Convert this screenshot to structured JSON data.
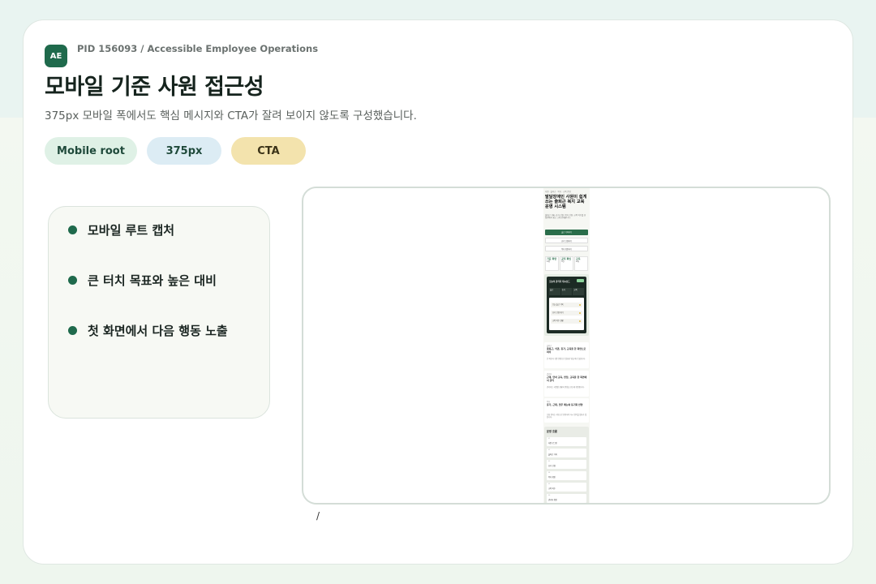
{
  "header": {
    "brand_badge": "AE",
    "pid_text": "PID 156093 / Accessible Employee Operations",
    "title": "모바일 기준 사원 접근성",
    "subtitle": "375px 모바일 폭에서도 핵심 메시지와 CTA가 잘려 보이지 않도록 구성했습니다."
  },
  "chips": [
    "Mobile root",
    "375px",
    "CTA"
  ],
  "colors": {
    "accent": "#1f6a4c",
    "chip_green": "#dff1e6",
    "chip_blue": "#dcecf4",
    "chip_yellow": "#f3e3ad"
  },
  "bullets": [
    "모바일 루트 캡처",
    "큰 터치 목표와 높은 대비",
    "첫 화면에서 다음 행동 노출"
  ],
  "preview_caption": "/",
  "mobile": {
    "top_label": "사원 · 출퇴근 · 복지 · 교육 운영",
    "headline": "발달장애인 사원이 쉽게 쓰는 출퇴근 복지 교육 운영 시스템",
    "intro": "출퇴근 기록, 휴가 신청, 복지 신청, 교육 이수를 한 화면에서 쉽고 크게 안내합니다.",
    "primary_button": "출근 기록하기",
    "button_2": "휴가 신청하기",
    "button_3": "복지 확인하기",
    "stats": [
      {
        "label": "기준 화면",
        "value": "1개"
      },
      {
        "label": "공지 확인",
        "value": "3건"
      },
      {
        "label": "교육",
        "value": "2개"
      }
    ],
    "dashboard": {
      "title": "오늘의 관리자 대시보드",
      "kpis": [
        "출근",
        "휴가",
        "교육"
      ],
      "rows": [
        "오늘 출근 기록",
        "휴가 신청 대기",
        "교육 이수 현황"
      ]
    },
    "sections": [
      {
        "tag": "출퇴근",
        "title": "출퇴근, 식권, 휴가, 교육을 한 화면으로 처리",
        "text": "큰 버튼과 쉬운 문장으로 필요한 일을 바로 찾습니다."
      },
      {
        "tag": "관리자",
        "title": "근태, 연차 교육, 면담, 교육을 한 화면에서 관리",
        "text": "관리자는 사원별 현황과 알림을 한눈에 확인합니다."
      },
      {
        "tag": "복지",
        "title": "휴가, 근태, 업무 메뉴와 동기화 반영",
        "text": "신청 결과는 자동으로 반영되어 다시 입력할 필요가 없습니다."
      }
    ],
    "flow": {
      "title": "운영 흐름",
      "steps": [
        {
          "num": "01",
          "label": "사원 로그인"
        },
        {
          "num": "02",
          "label": "출퇴근 기록"
        },
        {
          "num": "03",
          "label": "휴가 신청"
        },
        {
          "num": "04",
          "label": "복지 확인"
        },
        {
          "num": "05",
          "label": "교육 이수"
        },
        {
          "num": "06",
          "label": "관리자 확인"
        }
      ]
    }
  }
}
